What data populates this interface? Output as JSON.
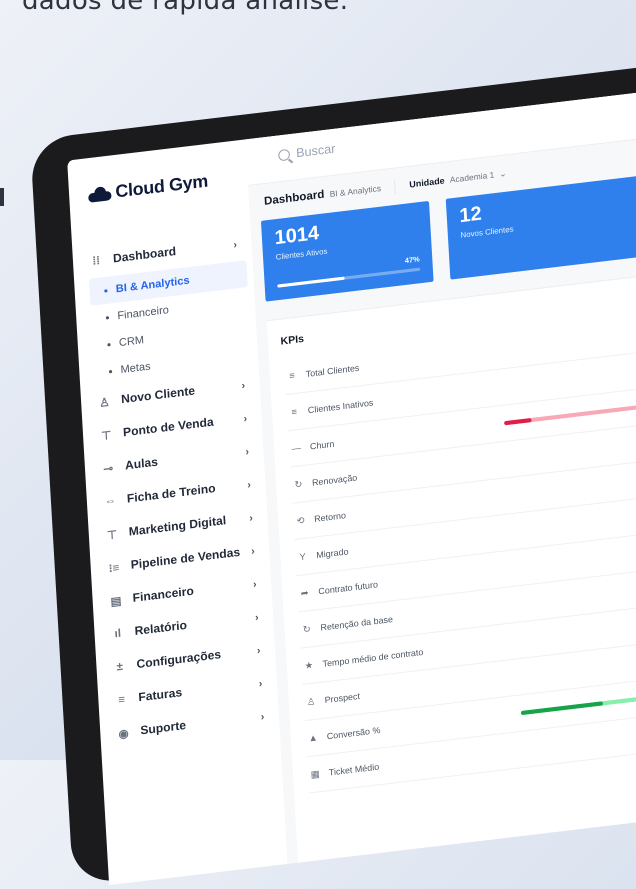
{
  "promo": {
    "headline": "dados de rápida análise."
  },
  "app": {
    "brand": "Cloud Gym",
    "collapse_icon": "arrow-left-circle-icon",
    "search_placeholder": "Buscar",
    "breadcrumb": {
      "title": "Dashboard",
      "subtitle": "BI & Analytics"
    },
    "unit_filter": {
      "label": "Unidade",
      "value": "Academia 1",
      "caret": "⌄"
    }
  },
  "sidebar": {
    "dashboard": {
      "label": "Dashboard",
      "icon": "grid-icon",
      "chevron": "›"
    },
    "sub_items": [
      {
        "label": "BI & Analytics",
        "active": true
      },
      {
        "label": "Financeiro",
        "active": false
      },
      {
        "label": "CRM",
        "active": false
      },
      {
        "label": "Metas",
        "active": false
      }
    ],
    "items": [
      {
        "label": "Novo Cliente",
        "icon": "user-icon",
        "chevron": "›"
      },
      {
        "label": "Ponto de Venda",
        "icon": "store-icon",
        "chevron": "›"
      },
      {
        "label": "Aulas",
        "icon": "dumbbell-icon",
        "chevron": "›"
      },
      {
        "label": "Ficha de Treino",
        "icon": "swap-icon",
        "chevron": "›"
      },
      {
        "label": "Marketing Digital",
        "icon": "megaphone-icon",
        "chevron": "›"
      },
      {
        "label": "Pipeline de Vendas",
        "icon": "pipeline-icon",
        "chevron": "›"
      },
      {
        "label": "Financeiro",
        "icon": "wallet-icon",
        "chevron": "›"
      },
      {
        "label": "Relatório",
        "icon": "bar-chart-icon",
        "chevron": "›"
      },
      {
        "label": "Configurações",
        "icon": "sliders-icon",
        "chevron": "›"
      },
      {
        "label": "Faturas",
        "icon": "invoice-icon",
        "chevron": "›"
      },
      {
        "label": "Suporte",
        "icon": "support-icon",
        "chevron": "›"
      }
    ]
  },
  "cards": [
    {
      "value": "1014",
      "label": "Clientes Ativos",
      "progress_pct": 47,
      "progress_label": "47%"
    },
    {
      "value": "12",
      "label": "Novos Clientes"
    }
  ],
  "kpis": {
    "title": "KPIs",
    "rows": [
      {
        "label": "Total Clientes",
        "icon": "list-icon"
      },
      {
        "label": "Clientes Inativos",
        "icon": "list-icon"
      },
      {
        "label": "Churn",
        "icon": "minus-icon",
        "bar": {
          "color": "#e11d48",
          "soft": "#f9a8b8",
          "fill": 0.2
        }
      },
      {
        "label": "Renovação",
        "icon": "refresh-icon"
      },
      {
        "label": "Retorno",
        "icon": "return-icon"
      },
      {
        "label": "Migrado",
        "icon": "migrate-icon"
      },
      {
        "label": "Contrato futuro",
        "icon": "forward-icon"
      },
      {
        "label": "Retenção da base",
        "icon": "refresh-icon"
      },
      {
        "label": "Tempo médio de contrato",
        "icon": "star-icon"
      },
      {
        "label": "Prospect",
        "icon": "user-icon"
      },
      {
        "label": "Conversão %",
        "icon": "bell-icon",
        "bar": {
          "color": "#16a34a",
          "soft": "#86efac",
          "fill": 0.6
        }
      },
      {
        "label": "Ticket Médio",
        "icon": "ticket-icon"
      }
    ]
  },
  "colors": {
    "accent": "#2f80ed",
    "brand": "#0f1a3a",
    "bezel": "#1b1b1d"
  }
}
